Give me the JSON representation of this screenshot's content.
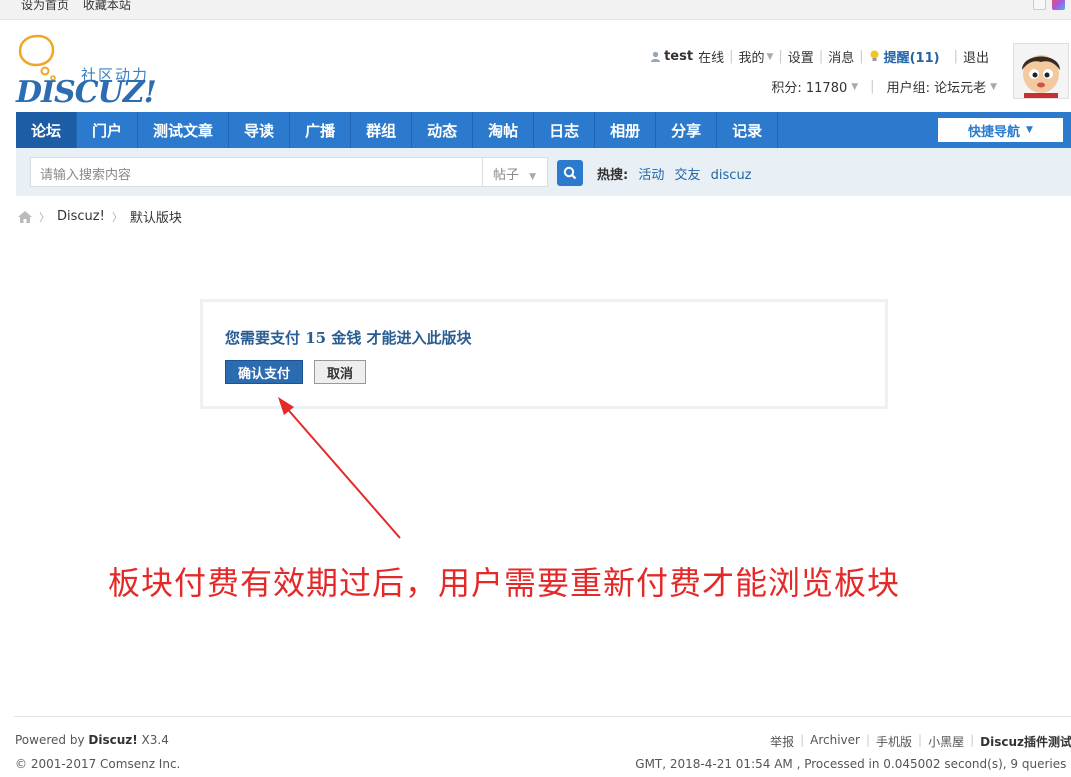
{
  "topbar": {
    "set_home": "设为首页",
    "bookmark": "收藏本站"
  },
  "logo": {
    "cn": "社区动力",
    "en": "DISCUZ!"
  },
  "user": {
    "username": "test",
    "online": "在线",
    "mine": "我的",
    "settings": "设置",
    "messages": "消息",
    "remind": "提醒(11)",
    "logout": "退出",
    "points_label": "积分: 11780",
    "group_label": "用户组: 论坛元老"
  },
  "nav": {
    "items": [
      "论坛",
      "门户",
      "测试文章",
      "导读",
      "广播",
      "群组",
      "动态",
      "淘帖",
      "日志",
      "相册",
      "分享",
      "记录"
    ],
    "quick_nav": "快捷导航"
  },
  "search": {
    "placeholder": "请输入搜索内容",
    "type": "帖子",
    "hot_label": "热搜:",
    "hot_keywords": [
      "活动",
      "交友",
      "discuz"
    ]
  },
  "breadcrumb": {
    "site": "Discuz!",
    "forum": "默认版块"
  },
  "paybox": {
    "message": "您需要支付 15 金钱 才能进入此版块",
    "confirm": "确认支付",
    "cancel": "取消"
  },
  "annotation": {
    "text": "板块付费有效期过后，用户需要重新付费才能浏览板块",
    "color": "#e52828"
  },
  "footer": {
    "powered_prefix": "Powered by ",
    "powered_brand": "Discuz!",
    "powered_version": " X3.4",
    "copyright": "© 2001-2017 Comsenz Inc.",
    "links": [
      "举报",
      "Archiver",
      "手机版",
      "小黑屋"
    ],
    "site_name": "Discuz插件测试",
    "stats": "GMT, 2018-4-21 01:54 AM , Processed in 0.045002 second(s), 9 queries ."
  },
  "colors": {
    "nav_bg": "#2b7acd",
    "nav_active": "#1c5da6",
    "link": "#2366a8"
  }
}
